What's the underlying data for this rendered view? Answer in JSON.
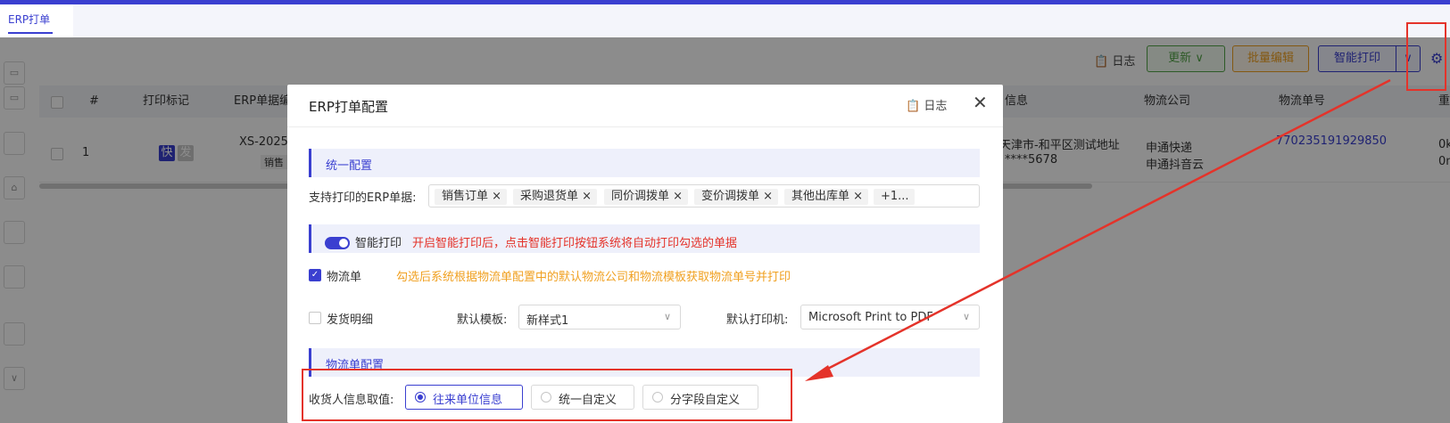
{
  "tabbar": {
    "active_tab": "ERP打单"
  },
  "toolbar": {
    "log_label": "日志",
    "update_label": "更新",
    "batch_edit_label": "批量编辑",
    "smart_print_label": "智能打印"
  },
  "table": {
    "headers": [
      "#",
      "打印标记",
      "ERP单据编",
      "信息",
      "物流公司",
      "物流单号",
      "重"
    ],
    "row": {
      "index": "1",
      "badge_fast": "快",
      "badge_send": "发",
      "erp_no": "XS-2025",
      "erp_type": "销售",
      "address": "天津市-和平区测试地址",
      "phone": "****5678",
      "logistics_1": "申通快递",
      "logistics_2": "申通抖音云",
      "tracking_no": "770235191929850",
      "weight_1": "0k",
      "weight_2": "0m"
    }
  },
  "modal": {
    "title": "ERP打单配置",
    "log_label": "日志",
    "section_unified": "统一配置",
    "erp_docs_label": "支持打印的ERP单据:",
    "erp_docs_tags": [
      "销售订单",
      "采购退货单",
      "同价调拨单",
      "变价调拨单",
      "其他出库单"
    ],
    "erp_docs_more": "+1...",
    "smart_print_label": "智能打印",
    "smart_print_hint": "开启智能打印后，点击智能打印按钮系统将自动打印勾选的单据",
    "logistics_label": "物流单",
    "logistics_hint": "勾选后系统根据物流单配置中的默认物流公司和物流模板获取物流单号并打印",
    "shipping_detail_label": "发货明细",
    "default_template_label": "默认模板:",
    "default_template_value": "新样式1",
    "default_printer_label": "默认打印机:",
    "default_printer_value": "Microsoft Print to PDF",
    "section_logistics": "物流单配置",
    "receiver_label": "收货人信息取值:",
    "receiver_options": [
      "往来单位信息",
      "统一自定义",
      "分字段自定义"
    ]
  },
  "colors": {
    "accent": "#3a3fd0",
    "annotation": "#e4332a",
    "hint_red": "#e4332a",
    "hint_orange": "#f0a020",
    "update_green": "#52a447"
  }
}
